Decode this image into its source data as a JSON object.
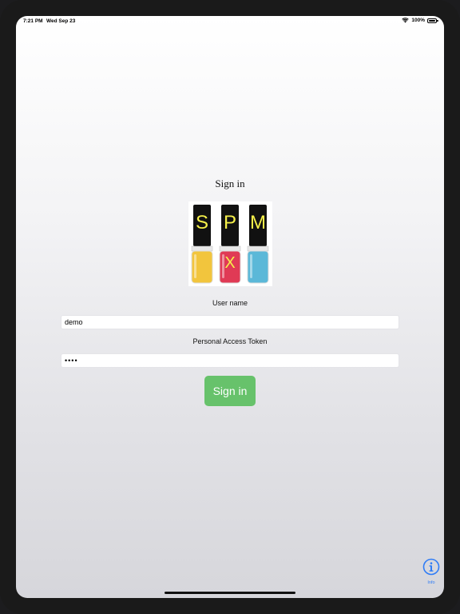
{
  "status_bar": {
    "time": "7:21 PM",
    "date": "Wed Sep 23",
    "battery": "100%",
    "wifi_icon": "wifi-icon",
    "battery_icon": "battery-icon"
  },
  "title": "Sign in",
  "logo": {
    "letters": [
      "S",
      "P",
      "M",
      "X"
    ],
    "bottle_colors": [
      "#f2c53d",
      "#e03a55",
      "#5bb8d8"
    ],
    "letter_color": "#f5f04a"
  },
  "form": {
    "username_label": "User name",
    "username_value": "demo",
    "token_label": "Personal Access Token",
    "token_value": "••••"
  },
  "signin_button": {
    "label": "Sign in",
    "color": "#67c26b"
  },
  "info": {
    "label": "Info",
    "icon": "info-circle-icon",
    "color": "#2f7cf6"
  }
}
